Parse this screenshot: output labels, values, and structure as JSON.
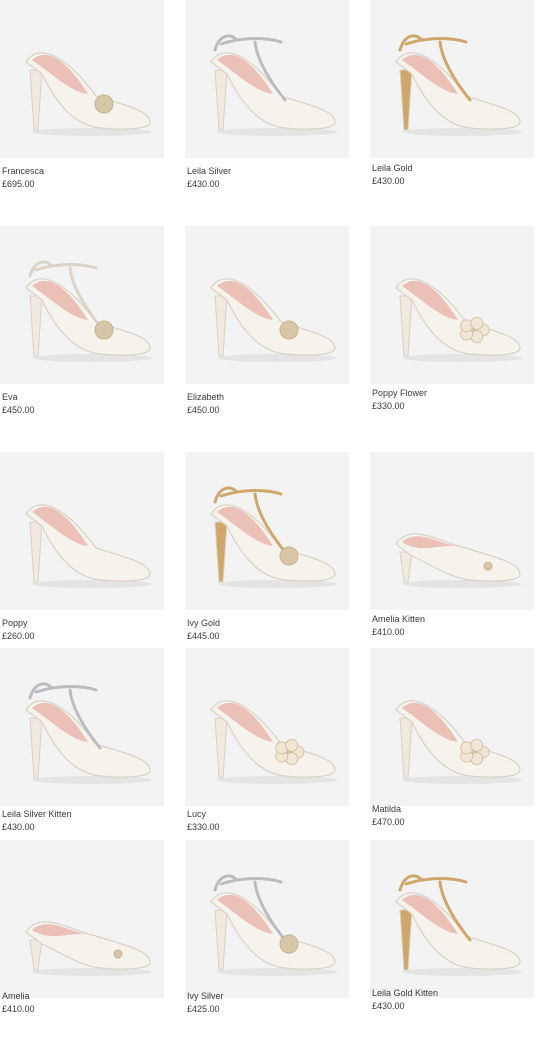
{
  "products": [
    {
      "name": "Francesca",
      "price": "£695.00",
      "style": "jewel"
    },
    {
      "name": "Leila Silver",
      "price": "£430.00",
      "style": "silver-strap"
    },
    {
      "name": "Leila Gold",
      "price": "£430.00",
      "style": "gold-strap"
    },
    {
      "name": "Eva",
      "price": "£450.00",
      "style": "tbar"
    },
    {
      "name": "Elizabeth",
      "price": "£450.00",
      "style": "brooch"
    },
    {
      "name": "Poppy Flower",
      "price": "£330.00",
      "style": "flower"
    },
    {
      "name": "Poppy",
      "price": "£260.00",
      "style": "plain"
    },
    {
      "name": "Ivy Gold",
      "price": "£445.00",
      "style": "gold-tbar"
    },
    {
      "name": "Amelia Kitten",
      "price": "£410.00",
      "style": "kitten"
    },
    {
      "name": "Leila Silver Kitten",
      "price": "£430.00",
      "style": "silver-strap"
    },
    {
      "name": "Lucy",
      "price": "£330.00",
      "style": "flower"
    },
    {
      "name": "Matilda",
      "price": "£470.00",
      "style": "flower"
    },
    {
      "name": "Amelia",
      "price": "£410.00",
      "style": "kitten"
    },
    {
      "name": "Ivy Silver",
      "price": "£425.00",
      "style": "silver-tbar"
    },
    {
      "name": "Leila Gold Kitten",
      "price": "£430.00",
      "style": "gold-strap"
    }
  ]
}
